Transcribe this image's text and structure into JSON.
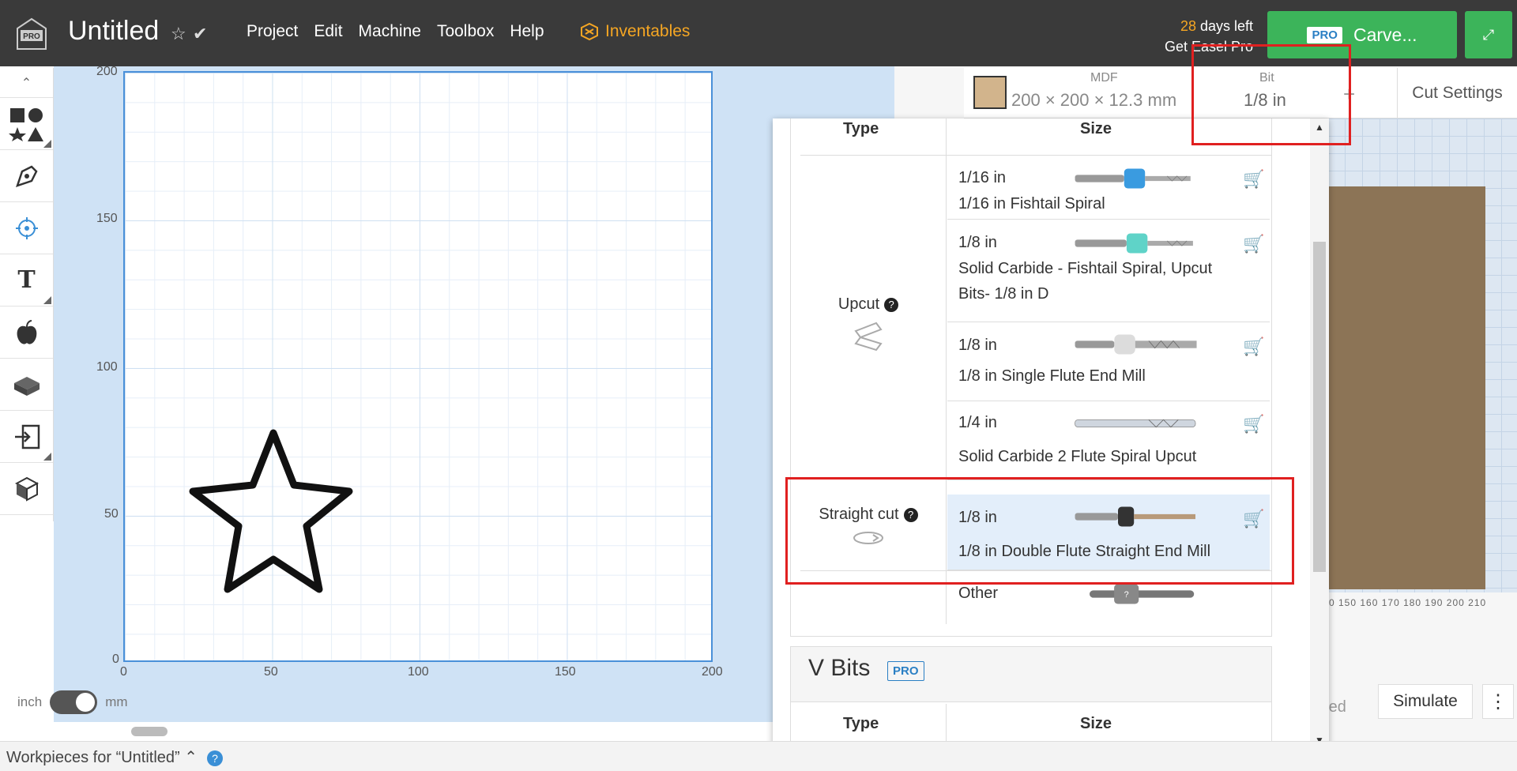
{
  "header": {
    "title": "Untitled",
    "menu": [
      "Project",
      "Edit",
      "Machine",
      "Toolbox",
      "Help"
    ],
    "brand": "Inventables",
    "days_left_num": "28",
    "days_left_text": "days left",
    "get_pro": "Get Easel Pro",
    "pro_badge": "PRO",
    "carve": "Carve..."
  },
  "canvas": {
    "y_ticks": [
      "200",
      "150",
      "100",
      "50",
      "0"
    ],
    "x_ticks": [
      "0",
      "50",
      "100",
      "150",
      "200"
    ],
    "unit_left": "inch",
    "unit_right": "mm"
  },
  "material_bar": {
    "material": "MDF",
    "dimensions": "200 × 200 × 12.3 mm",
    "bit_label": "Bit",
    "bit_value": "1/8 in",
    "plus": "+",
    "cut_settings": "Cut Settings"
  },
  "dropdown": {
    "col_type": "Type",
    "col_size": "Size",
    "upcut_label": "Upcut",
    "straight_label": "Straight cut",
    "rows": [
      {
        "size": "1/16 in",
        "name": "1/16 in Fishtail Spiral",
        "color": "#3a9be0"
      },
      {
        "size": "1/8 in",
        "name": "Solid Carbide - Fishtail Spiral, Upcut Bits- 1/8 in D",
        "color": "#5fd3c8"
      },
      {
        "size": "1/8 in",
        "name": "1/8 in Single Flute End Mill",
        "color": "#dcdcdc"
      },
      {
        "size": "1/4 in",
        "name": "Solid Carbide 2 Flute Spiral Upcut",
        "color": "#bbbbbb"
      },
      {
        "size": "1/8 in",
        "name": "1/8 in Double Flute Straight End Mill",
        "color": "#333333"
      },
      {
        "size": "Other",
        "name": "",
        "color": "#777777"
      }
    ],
    "vbits_title": "V Bits",
    "vbits_pro": "PRO",
    "vbits_col_type": "Type",
    "vbits_col_size": "Size"
  },
  "preview": {
    "ticks": "0 150 160 170 180 190 200 210",
    "detailed": "tailed",
    "simulate": "Simulate"
  },
  "footer": {
    "workpieces": "Workpieces for “Untitled”"
  }
}
